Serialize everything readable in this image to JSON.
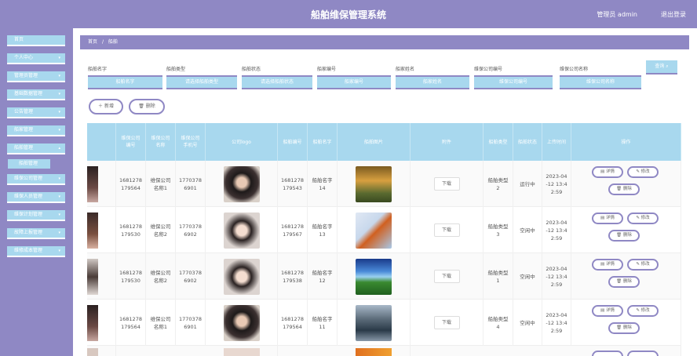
{
  "app": {
    "title": "船舶维保管理系统",
    "user": "管理员 admin",
    "logout": "退出登录"
  },
  "sidebar": {
    "items": [
      {
        "label": "首页",
        "arrow": ""
      },
      {
        "label": "个人中心",
        "arrow": "▾"
      },
      {
        "label": "管理员管理",
        "arrow": "▾"
      },
      {
        "label": "基础数据管理",
        "arrow": "▾"
      },
      {
        "label": "公告管理",
        "arrow": "▾"
      },
      {
        "label": "船家管理",
        "arrow": "▾"
      },
      {
        "label": "船舶管理",
        "arrow": "▴"
      },
      {
        "label": "维保公司管理",
        "arrow": "▾"
      },
      {
        "label": "维保人员管理",
        "arrow": "▾"
      },
      {
        "label": "维保计划管理",
        "arrow": "▾"
      },
      {
        "label": "故障上报管理",
        "arrow": "▾"
      },
      {
        "label": "维修成本管理",
        "arrow": "▾"
      }
    ],
    "submenu": "船舶管理"
  },
  "breadcrumb": {
    "home": "首页",
    "sep": "/",
    "current": "船舶"
  },
  "filters": [
    {
      "label": "船舶名字",
      "placeholder": "船舶名字"
    },
    {
      "label": "船舶类型",
      "placeholder": "请选择船舶类型"
    },
    {
      "label": "船舶状态",
      "placeholder": "请选择船舶状态"
    },
    {
      "label": "船家编号",
      "placeholder": "船家编号"
    },
    {
      "label": "船家姓名",
      "placeholder": "船家姓名"
    },
    {
      "label": "维保公司编号",
      "placeholder": "维保公司编号"
    },
    {
      "label": "维保公司名称",
      "placeholder": "维保公司名称"
    }
  ],
  "search_label": "查询",
  "add_label": "新增",
  "delete_label": "删除",
  "columns": [
    "",
    "维保公司\n编号",
    "维保公司\n名称",
    "维保公司\n手机号",
    "公司logo",
    "船舶编号",
    "船舶名字",
    "船舶图片",
    "附件",
    "船舶类型",
    "船舶状态",
    "上传时间",
    "操作"
  ],
  "rows": [
    {
      "company_no": "1681278\n179564",
      "company_name": "维保公司\n名称1",
      "phone": "1770378\n6901",
      "ship_no": "1681278\n179543",
      "ship_name": "船舶名字\n14",
      "download": "下载",
      "ship_type": "船舶类型\n2",
      "status": "运行中",
      "time": "2023-04\n-12 13:4\n2:59"
    },
    {
      "company_no": "1681278\n179530",
      "company_name": "维保公司\n名称2",
      "phone": "1770378\n6902",
      "ship_no": "1681278\n179567",
      "ship_name": "船舶名字\n13",
      "download": "下载",
      "ship_type": "船舶类型\n3",
      "status": "空闲中",
      "time": "2023-04\n-12 13:4\n2:59"
    },
    {
      "company_no": "1681278\n179530",
      "company_name": "维保公司\n名称2",
      "phone": "1770378\n6902",
      "ship_no": "1681278\n179538",
      "ship_name": "船舶名字\n12",
      "download": "下载",
      "ship_type": "船舶类型\n1",
      "status": "空闲中",
      "time": "2023-04\n-12 13:4\n2:59"
    },
    {
      "company_no": "1681278\n179564",
      "company_name": "维保公司\n名称1",
      "phone": "1770378\n6901",
      "ship_no": "1681278\n179564",
      "ship_name": "船舶名字\n11",
      "download": "下载",
      "ship_type": "船舶类型\n4",
      "status": "空闲中",
      "time": "2023-04\n-12 13:4\n2:59"
    }
  ],
  "ops": {
    "detail": "详情",
    "edit": "修改",
    "delete": "删除"
  },
  "colors": {
    "primary": "#8f88c4",
    "accent": "#a8d8ee"
  }
}
